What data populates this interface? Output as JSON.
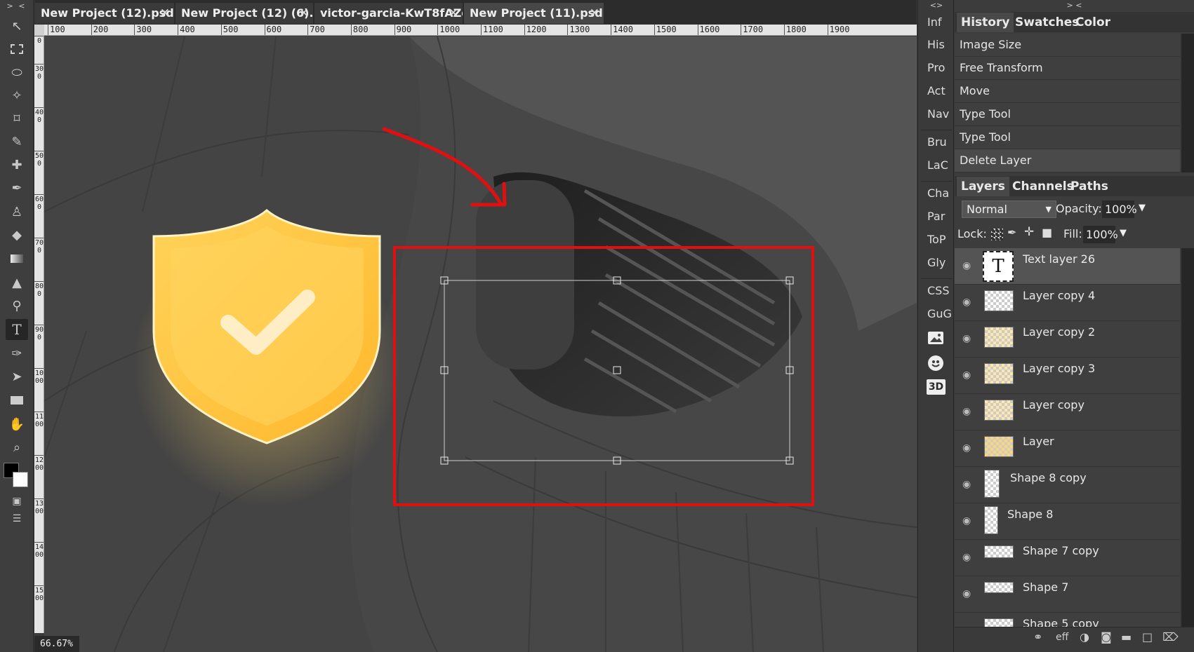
{
  "toolbar": {
    "header": "> <",
    "tools": [
      "move-tool",
      "marquee-tool",
      "lasso-tool",
      "magic-wand-tool",
      "crop-tool",
      "eyedropper-tool",
      "healing-tool",
      "brush-tool",
      "stamp-tool",
      "eraser-tool",
      "gradient-tool",
      "blur-tool",
      "dodge-tool",
      "type-tool",
      "pen-tool",
      "path-select-tool",
      "rectangle-tool",
      "hand-tool",
      "zoom-tool"
    ],
    "active_tool": "type-tool"
  },
  "tabs": [
    {
      "label": "New Project (12).psd *",
      "active": false
    },
    {
      "label": "New Project (12) (6).p",
      "active": false
    },
    {
      "label": "victor-garcia-KwT8fAZq",
      "active": false
    },
    {
      "label": "New Project (11).psd *",
      "active": true
    }
  ],
  "ruler": {
    "horizontal": [
      "100",
      "200",
      "300",
      "400",
      "500",
      "600",
      "700",
      "800",
      "900",
      "1000",
      "1100",
      "1200",
      "1300",
      "1400",
      "1500",
      "1600",
      "1700",
      "1800",
      "1900"
    ],
    "vertical": [
      "0",
      "300",
      "400",
      "500",
      "600",
      "700",
      "800",
      "900",
      "1000",
      "1100",
      "1200",
      "1300",
      "1400",
      "1500"
    ]
  },
  "zoom": "66.67%",
  "mini_panel": {
    "header": "<>",
    "items": [
      "Inf",
      "His",
      "Pro",
      "Act",
      "Nav",
      "Bru",
      "LaC",
      "Cha",
      "Par",
      "ToP",
      "Gly",
      "CSS",
      "GuG",
      "3D"
    ],
    "icons": [
      "image-icon",
      "emoji-icon"
    ]
  },
  "right_panel": {
    "header": "> <",
    "history_tabs": [
      "History",
      "Swatches",
      "Color"
    ],
    "history_items": [
      "Image Size",
      "Free Transform",
      "Move",
      "Type Tool",
      "Type Tool",
      "Delete Layer"
    ],
    "layer_tabs": [
      "Layers",
      "Channels",
      "Paths"
    ],
    "blend_mode": "Normal",
    "opacity_label": "Opacity:",
    "opacity_value": "100%",
    "lock_label": "Lock:",
    "fill_label": "Fill:",
    "fill_value": "100%",
    "layers": [
      {
        "name": "Text layer 26",
        "type": "text",
        "thumb_text": "T",
        "selected": true
      },
      {
        "name": "Layer copy 4",
        "type": "raster"
      },
      {
        "name": "Layer copy 2",
        "type": "raster"
      },
      {
        "name": "Layer copy 3",
        "type": "raster"
      },
      {
        "name": "Layer copy",
        "type": "raster"
      },
      {
        "name": "Layer",
        "type": "raster"
      },
      {
        "name": "Shape 8 copy",
        "type": "shape"
      },
      {
        "name": "Shape 8",
        "type": "shape"
      },
      {
        "name": "Shape 7 copy",
        "type": "shape"
      },
      {
        "name": "Shape 7",
        "type": "shape"
      },
      {
        "name": "Shape 5 copy",
        "type": "shape"
      }
    ],
    "footer_icons": [
      "link-icon",
      "eff",
      "adjustment-icon",
      "mask-icon",
      "folder-icon",
      "new-layer-icon",
      "trash-icon"
    ],
    "footer_eff": "eff"
  },
  "colors": {
    "accent_red": "#e01010",
    "shield": "#ffc53d"
  }
}
